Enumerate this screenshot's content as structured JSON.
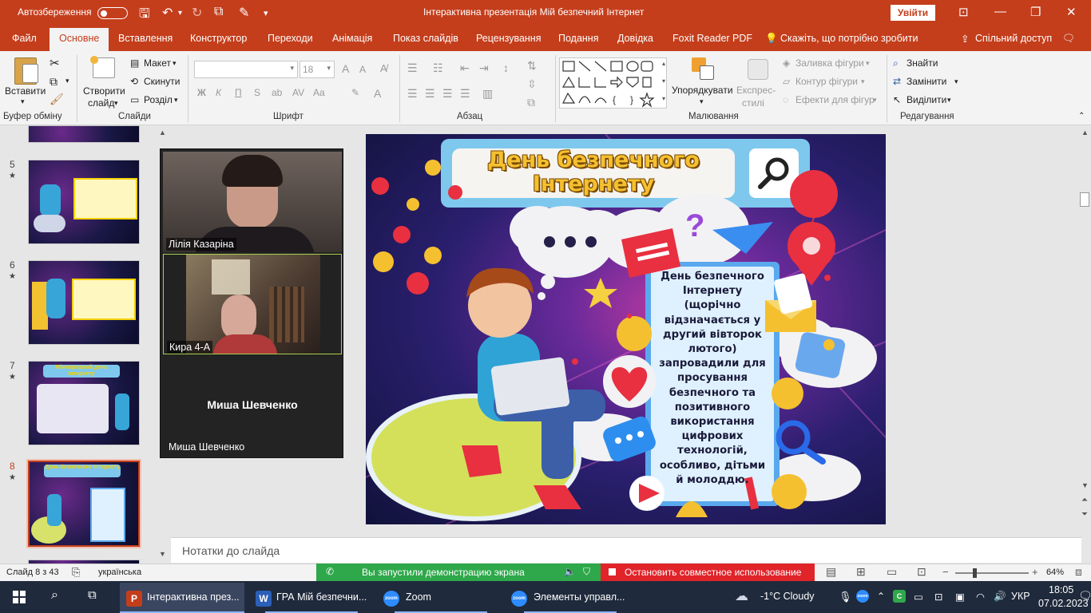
{
  "window": {
    "autosave_label": "Автозбереження",
    "title": "Інтерактивна презентація Мій безпечний Інтернет",
    "sign_in": "Увійти"
  },
  "tabs": [
    {
      "label": "Файл"
    },
    {
      "label": "Основне"
    },
    {
      "label": "Вставлення"
    },
    {
      "label": "Конструктор"
    },
    {
      "label": "Переходи"
    },
    {
      "label": "Анімація"
    },
    {
      "label": "Показ слайдів"
    },
    {
      "label": "Рецензування"
    },
    {
      "label": "Подання"
    },
    {
      "label": "Довідка"
    },
    {
      "label": "Foxit Reader PDF"
    },
    {
      "label": "Скажіть, що потрібно зробити"
    },
    {
      "label": "Спільний доступ"
    }
  ],
  "ribbon": {
    "paste": "Вставити",
    "clipboard_group": "Буфер обміну",
    "new_slide_1": "Створити",
    "new_slide_2": "слайд",
    "layout": "Макет",
    "reset": "Скинути",
    "section": "Розділ",
    "slides_group": "Слайди",
    "font_size": "18",
    "bold": "Ж",
    "italic": "К",
    "underline": "П",
    "strike": "S",
    "font_group": "Шрифт",
    "paragraph_group": "Абзац",
    "arrange": "Упорядкувати",
    "quick_styles_1": "Експрес-",
    "quick_styles_2": "стилі",
    "shape_fill": "Заливка фігури",
    "shape_outline": "Контур фігури",
    "shape_effects": "Ефекти для фігур",
    "drawing_group": "Малювання",
    "find": "Знайти",
    "replace": "Замінити",
    "select": "Виділити",
    "editing_group": "Редагування"
  },
  "thumbnails": [
    {
      "num": "5",
      "star": "★",
      "title": ""
    },
    {
      "num": "6",
      "star": "★",
      "title": ""
    },
    {
      "num": "7",
      "star": "★",
      "title": "Міжнародний день Інтернету"
    },
    {
      "num": "8",
      "star": "★",
      "title": "День безпечного Інтернету"
    }
  ],
  "zoom_panel": {
    "participants": [
      {
        "name": "Лілія Казаріна"
      },
      {
        "name": "Кира 4-А"
      },
      {
        "name": "Миша Шевченко"
      }
    ],
    "center_name": "Миша Шевченко"
  },
  "slide": {
    "title": "День безпечного Інтернету",
    "title_line1": "День безпечного",
    "title_line2": "Інтернету",
    "body_lines": [
      "День безпечного",
      "Інтернету",
      "(щорічно",
      "відзначається у",
      "другий  вівторок",
      "лютого)",
      "запровадили для",
      "просування",
      "безпечного та",
      "позитивного",
      "використання",
      "цифрових",
      "технологій,",
      "особливо, дітьми",
      "й молоддю."
    ]
  },
  "notes_placeholder": "Нотатки до слайда",
  "status": {
    "slide_of": "Слайд 8 з 43",
    "language": "українська",
    "zoom_share": "Вы запустили демонстрацию экрана",
    "stop_share": "Остановить совместное использование",
    "zoom_level": "64%"
  },
  "taskbar": {
    "items": [
      {
        "label": "Інтерактивна през..."
      },
      {
        "label": "ГРА Мій безпечни..."
      },
      {
        "label": "Zoom"
      },
      {
        "label": "Элементы управл..."
      }
    ],
    "weather": "-1°C  Cloudy",
    "lang": "УКР",
    "time": "18:05",
    "date": "07.02.2023"
  },
  "colors": {
    "accent": "#c43e1c",
    "zoom_green": "#2ea84a",
    "stop_red": "#e0242a",
    "taskbar": "#1f2a3c"
  }
}
